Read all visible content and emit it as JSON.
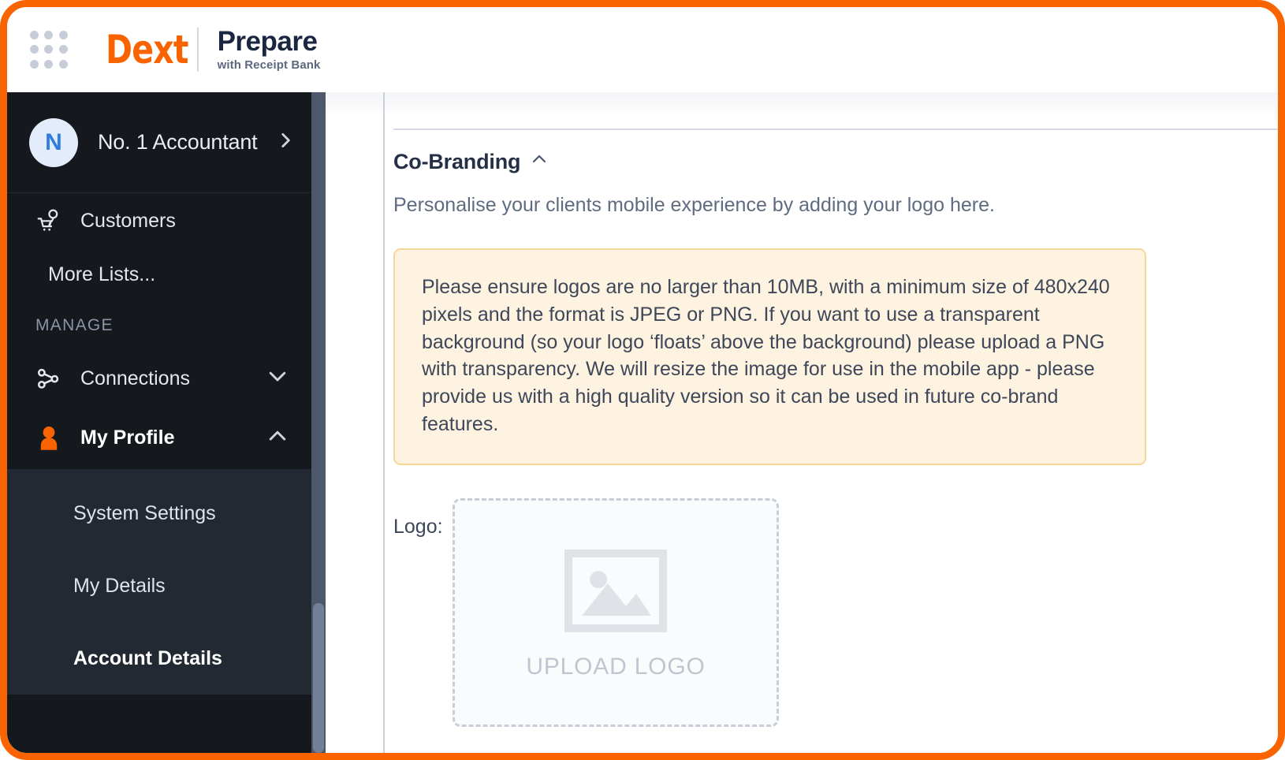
{
  "header": {
    "grid_icon": "apps-grid-icon",
    "brand_name": "Dext",
    "product_name": "Prepare",
    "product_subtitle": "with Receipt Bank"
  },
  "sidebar": {
    "profile": {
      "avatar_initial": "N",
      "name": "No. 1 Accountant",
      "chevron": "chevron-right-icon"
    },
    "items": [
      {
        "label": "Customers",
        "icon": "customers-cart-icon"
      },
      {
        "label": "More Lists...",
        "icon": ""
      }
    ],
    "section_label": "MANAGE",
    "manage_items": [
      {
        "label": "Connections",
        "icon": "connections-share-icon",
        "caret": "chevron-down-icon",
        "expanded": false
      },
      {
        "label": "My Profile",
        "icon": "profile-person-icon",
        "caret": "chevron-up-icon",
        "expanded": true
      }
    ],
    "submenu": [
      {
        "label": "System Settings",
        "active": false
      },
      {
        "label": "My Details",
        "active": false
      },
      {
        "label": "Account Details",
        "active": true
      }
    ]
  },
  "main": {
    "section_title": "Co-Branding",
    "section_caret": "chevron-up-icon",
    "section_subtitle": "Personalise your clients mobile experience by adding your logo here.",
    "notice": "Please ensure logos are no larger than 10MB, with a minimum size of 480x240 pixels and the format is JPEG or PNG. If you want to use a transparent background (so your logo ‘floats’ above the background) please upload a PNG with transparency. We will resize the image for use in the mobile app - please provide us with a high quality version so it can be used in future co-brand features.",
    "logo_label": "Logo:",
    "upload_text": "UPLOAD LOGO",
    "upload_icon": "image-placeholder-icon"
  },
  "colors": {
    "brand_orange": "#fa6400",
    "sidebar_bg": "#15181d",
    "submenu_bg": "#222932",
    "notice_bg": "#fdf3e0",
    "notice_border": "#f6d69a",
    "avatar_bg": "#e3ecfb",
    "avatar_text": "#2f7de1"
  }
}
